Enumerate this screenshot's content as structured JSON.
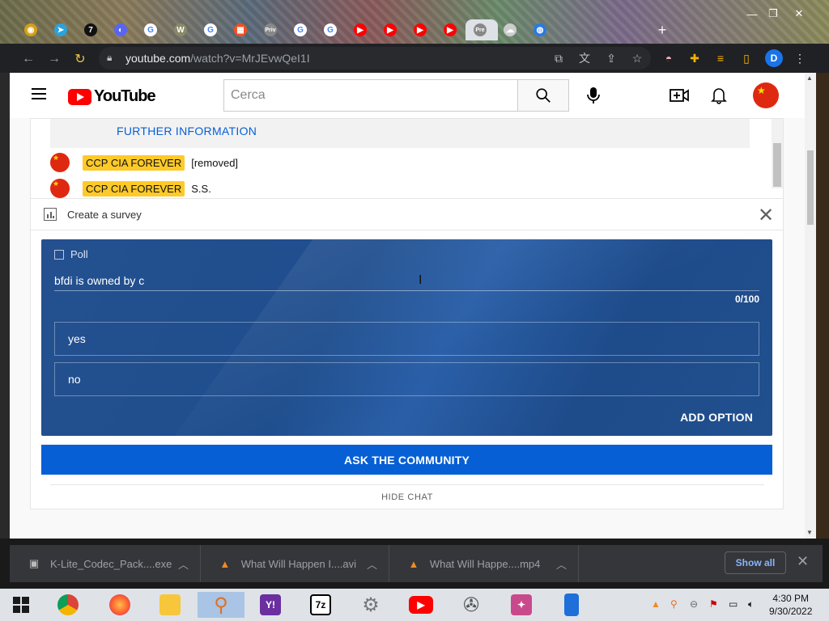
{
  "browser": {
    "url_host": "youtube.com",
    "url_path": "/watch?v=MrJEvwQeI1I",
    "profile_initial": "D",
    "tabs": [
      {
        "icon": "chrome-icon",
        "color": "#d4a017",
        "glyph": "◉"
      },
      {
        "icon": "telegram-icon",
        "color": "#2aa3dd",
        "glyph": "➤"
      },
      {
        "icon": "seven-tv-icon",
        "color": "#111111",
        "glyph": "7"
      },
      {
        "icon": "discord-icon",
        "color": "#5865f2",
        "glyph": "◐"
      },
      {
        "icon": "google-icon",
        "color": "#ffffff",
        "glyph": "G"
      },
      {
        "icon": "wiki-icon",
        "color": "#8a8a6a",
        "glyph": "W"
      },
      {
        "icon": "google-icon",
        "color": "#ffffff",
        "glyph": "G"
      },
      {
        "icon": "microsoft-icon",
        "color": "#f25022",
        "glyph": "▦"
      },
      {
        "icon": "page-icon",
        "color": "#888888",
        "glyph": "Priv"
      },
      {
        "icon": "google-icon",
        "color": "#ffffff",
        "glyph": "G"
      },
      {
        "icon": "google-icon",
        "color": "#ffffff",
        "glyph": "G"
      },
      {
        "icon": "youtube-icon",
        "color": "#ff0000",
        "glyph": "▶"
      },
      {
        "icon": "youtube-icon",
        "color": "#ff0000",
        "glyph": "▶"
      },
      {
        "icon": "youtube-icon",
        "color": "#ff0000",
        "glyph": "▶"
      },
      {
        "icon": "youtube-icon",
        "color": "#ff0000",
        "glyph": "▶"
      },
      {
        "icon": "page-icon",
        "color": "#888888",
        "glyph": "Pre"
      },
      {
        "icon": "cloud-icon",
        "color": "#cccccc",
        "glyph": "☁"
      },
      {
        "icon": "globe-icon",
        "color": "#2a7ae2",
        "glyph": "◍"
      }
    ],
    "new_tab": "+"
  },
  "youtube": {
    "logo_text": "YouTube",
    "search_placeholder": "Cerca"
  },
  "chat": {
    "further_information": "FURTHER INFORMATION",
    "messages": [
      {
        "author": "CCP CIA FOREVER",
        "text": "[removed]"
      },
      {
        "author": "CCP CIA FOREVER",
        "text": "S.S."
      }
    ],
    "create_survey_label": "Create a survey",
    "poll": {
      "header": "Poll",
      "question": "bfdi is owned by c",
      "counter": "0/100",
      "options": [
        "yes",
        "no"
      ],
      "add_option": "ADD OPTION"
    },
    "ask_button": "ASK THE COMMUNITY",
    "hide_chat": "HIDE CHAT"
  },
  "downloads": {
    "items": [
      {
        "name": "K-Lite_Codec_Pack....exe",
        "icon": "installer-icon"
      },
      {
        "name": "What Will Happen I....avi",
        "icon": "vlc-icon"
      },
      {
        "name": "What Will Happe....mp4",
        "icon": "vlc-icon"
      }
    ],
    "show_all": "Show all"
  },
  "taskbar": {
    "time": "4:30 PM",
    "date": "9/30/2022"
  },
  "colors": {
    "accent_blue": "#065fd4",
    "poll_bg": "#24508f",
    "author_badge": "#ffca28",
    "youtube_red": "#ff0000"
  }
}
